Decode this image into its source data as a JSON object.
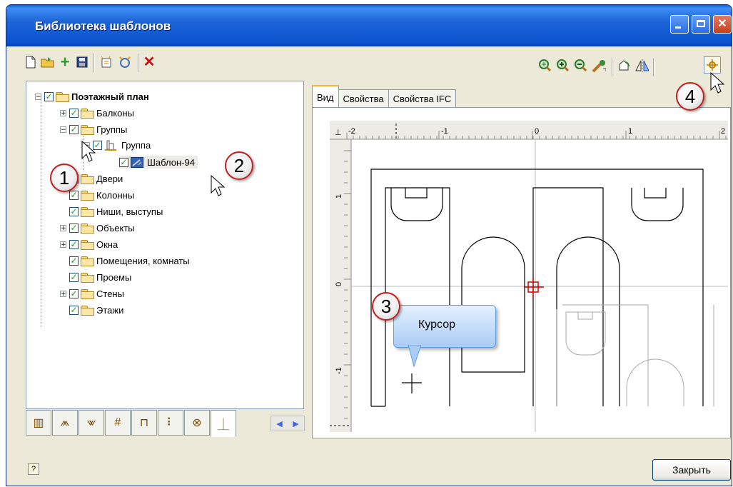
{
  "window": {
    "title": "Библиотека шаблонов"
  },
  "toolbar": {
    "left_icons": [
      "new-file-icon",
      "open-folder-icon",
      "add-icon",
      "save-icon",
      "new-template-icon",
      "new-group-icon",
      "delete-icon"
    ],
    "right_icons": [
      "zoom-window-icon",
      "zoom-in-icon",
      "zoom-out-icon",
      "zoom-all-icon",
      "rotate-icon",
      "mirror-icon",
      "set-basepoint-icon"
    ]
  },
  "tree": {
    "items": [
      {
        "label": "Поэтажный план",
        "bold": true
      },
      {
        "label": "Балконы"
      },
      {
        "label": "Группы"
      },
      {
        "label": "Группа"
      },
      {
        "label": "Шаблон-94"
      },
      {
        "label": "Двери"
      },
      {
        "label": "Колонны"
      },
      {
        "label": "Ниши, выступы"
      },
      {
        "label": "Объекты"
      },
      {
        "label": "Окна"
      },
      {
        "label": "Помещения, комнаты"
      },
      {
        "label": "Проемы"
      },
      {
        "label": "Стены"
      },
      {
        "label": "Этажи"
      }
    ]
  },
  "tabs": [
    {
      "label": "Вид"
    },
    {
      "label": "Свойства"
    },
    {
      "label": "Свойства IFC"
    }
  ],
  "ruler": {
    "x_ticks": [
      "-2",
      "-1",
      "0",
      "1",
      "2"
    ],
    "y_ticks": [
      "1",
      "0",
      "-1"
    ]
  },
  "callouts": {
    "c1": "1",
    "c2": "2",
    "c3": "3",
    "c4": "4",
    "bubble_text": "Курсор"
  },
  "footer": {
    "close_label": "Закрыть",
    "help_glyph": "?"
  },
  "colors": {
    "titlebar": "#0b55d0",
    "accent_red": "#d00000",
    "check_green": "#21a121"
  }
}
